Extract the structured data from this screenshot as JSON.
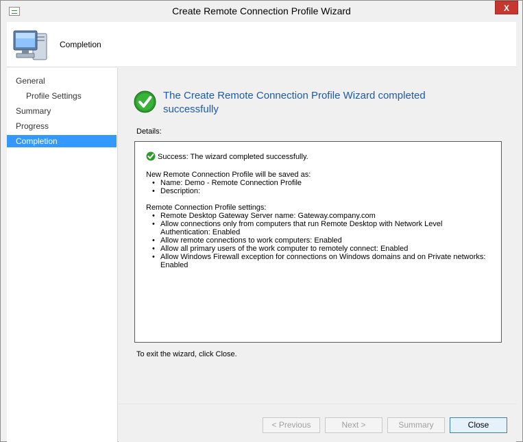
{
  "window": {
    "title": "Create Remote Connection Profile Wizard",
    "close_glyph": "X"
  },
  "header": {
    "title": "Completion",
    "icon": "computer-icon"
  },
  "nav": {
    "items": [
      {
        "label": "General",
        "sub": false,
        "selected": false
      },
      {
        "label": "Profile Settings",
        "sub": true,
        "selected": false
      },
      {
        "label": "Summary",
        "sub": false,
        "selected": false
      },
      {
        "label": "Progress",
        "sub": false,
        "selected": false
      },
      {
        "label": "Completion",
        "sub": false,
        "selected": true
      }
    ]
  },
  "main": {
    "heading": "The Create Remote Connection Profile Wizard completed successfully",
    "details_label": "Details:",
    "success_text": "Success: The wizard completed successfully.",
    "save_title": "New Remote Connection Profile will be saved as:",
    "save_items": [
      "Name: Demo - Remote Connection Profile",
      "Description:"
    ],
    "settings_title": "Remote Connection Profile settings:",
    "settings_items": [
      "Remote Desktop Gateway Server name: Gateway.company.com",
      "Allow connections only from computers that run Remote Desktop with Network Level Authentication: Enabled",
      "Allow remote connections to work computers: Enabled",
      "Allow all primary users of the work computer to remotely connect: Enabled",
      "Allow Windows Firewall exception for connections on Windows domains and on Private networks: Enabled"
    ],
    "exit_text": "To exit the wizard, click Close."
  },
  "footer": {
    "previous_label": "< Previous",
    "next_label": "Next >",
    "summary_label": "Summary",
    "close_label": "Close"
  },
  "colors": {
    "accent": "#3399ff",
    "heading": "#1c5aa6",
    "success": "#2e9b2e",
    "close_button": "#c7372f"
  }
}
